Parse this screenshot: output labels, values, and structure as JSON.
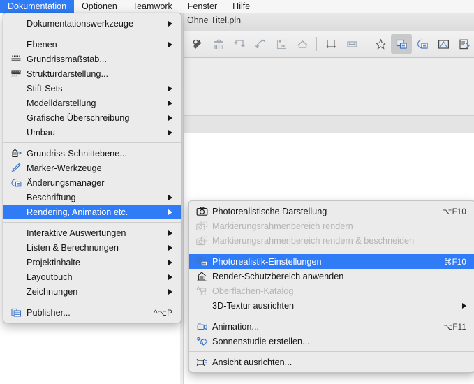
{
  "menubar": {
    "items": [
      {
        "label": "Dokumentation",
        "selected": true
      },
      {
        "label": "Optionen",
        "selected": false
      },
      {
        "label": "Teamwork",
        "selected": false
      },
      {
        "label": "Fenster",
        "selected": false
      },
      {
        "label": "Hilfe",
        "selected": false
      }
    ]
  },
  "window": {
    "title": "Ohne Titel.pln",
    "toolbar_icons": [
      "magic-wand-icon",
      "elevate-to-story-icon",
      "corner-snap-icon",
      "arc-tangent-icon",
      "move-to-layer-icon",
      "home-story-icon",
      "dimension-vertical-icon",
      "dimension-horizontal-icon",
      "favorites-star-icon",
      "layers-panel-icon",
      "renovation-filter-icon",
      "graphic-override-icon",
      "model-view-icon"
    ],
    "active_toolbar_icon": "layers-panel-icon"
  },
  "menu_dokumentation": {
    "name": "Dokumentation",
    "groups": [
      {
        "items": [
          {
            "label": "Dokumentationswerkzeuge",
            "icon": null,
            "submenu": true,
            "shortcut": "",
            "disabled": false,
            "highlight": false
          }
        ]
      },
      {
        "items": [
          {
            "label": "Ebenen",
            "icon": null,
            "submenu": true,
            "shortcut": "",
            "disabled": false,
            "highlight": false
          },
          {
            "label": "Grundrissmaßstab...",
            "icon": "scale-icon",
            "submenu": false,
            "shortcut": "",
            "disabled": false,
            "highlight": false
          },
          {
            "label": "Strukturdarstellung...",
            "icon": "structure-display-icon",
            "submenu": false,
            "shortcut": "",
            "disabled": false,
            "highlight": false
          },
          {
            "label": "Stift-Sets",
            "icon": null,
            "submenu": true,
            "shortcut": "",
            "disabled": false,
            "highlight": false
          },
          {
            "label": "Modelldarstellung",
            "icon": null,
            "submenu": true,
            "shortcut": "",
            "disabled": false,
            "highlight": false
          },
          {
            "label": "Grafische Überschreibung",
            "icon": null,
            "submenu": true,
            "shortcut": "",
            "disabled": false,
            "highlight": false
          },
          {
            "label": "Umbau",
            "icon": null,
            "submenu": true,
            "shortcut": "",
            "disabled": false,
            "highlight": false
          }
        ]
      },
      {
        "items": [
          {
            "label": "Grundriss-Schnittebene...",
            "icon": "floorplan-cutplane-icon",
            "submenu": false,
            "shortcut": "",
            "disabled": false,
            "highlight": false
          },
          {
            "label": "Marker-Werkzeuge",
            "icon": "marker-pen-icon",
            "submenu": false,
            "shortcut": "",
            "disabled": false,
            "highlight": false
          },
          {
            "label": "Änderungsmanager",
            "icon": "change-manager-icon",
            "submenu": false,
            "shortcut": "",
            "disabled": false,
            "highlight": false
          },
          {
            "label": "Beschriftung",
            "icon": null,
            "submenu": true,
            "shortcut": "",
            "disabled": false,
            "highlight": false
          },
          {
            "label": "Rendering, Animation etc.",
            "icon": null,
            "submenu": true,
            "shortcut": "",
            "disabled": false,
            "highlight": true
          }
        ]
      },
      {
        "items": [
          {
            "label": "Interaktive Auswertungen",
            "icon": null,
            "submenu": true,
            "shortcut": "",
            "disabled": false,
            "highlight": false
          },
          {
            "label": "Listen & Berechnungen",
            "icon": null,
            "submenu": true,
            "shortcut": "",
            "disabled": false,
            "highlight": false
          },
          {
            "label": "Projektinhalte",
            "icon": null,
            "submenu": true,
            "shortcut": "",
            "disabled": false,
            "highlight": false
          },
          {
            "label": "Layoutbuch",
            "icon": null,
            "submenu": true,
            "shortcut": "",
            "disabled": false,
            "highlight": false
          },
          {
            "label": "Zeichnungen",
            "icon": null,
            "submenu": true,
            "shortcut": "",
            "disabled": false,
            "highlight": false
          }
        ]
      },
      {
        "items": [
          {
            "label": "Publisher...",
            "icon": "publisher-icon",
            "submenu": false,
            "shortcut": "^⌥P",
            "disabled": false,
            "highlight": false
          }
        ]
      }
    ]
  },
  "menu_rendering": {
    "name": "Rendering, Animation etc.",
    "groups": [
      {
        "items": [
          {
            "label": "Photorealistische Darstellung",
            "icon": "camera-icon",
            "submenu": false,
            "shortcut": "⌥F10",
            "disabled": false,
            "highlight": false
          },
          {
            "label": "Markierungsrahmenbereich rendern",
            "icon": "camera-marquee-icon",
            "submenu": false,
            "shortcut": "",
            "disabled": true,
            "highlight": false
          },
          {
            "label": "Markierungsrahmenbereich rendern & beschneiden",
            "icon": "camera-marquee-crop-icon",
            "submenu": false,
            "shortcut": "",
            "disabled": true,
            "highlight": false
          }
        ]
      },
      {
        "items": [
          {
            "label": "Photorealistik-Einstellungen",
            "icon": "camera-settings-icon",
            "submenu": false,
            "shortcut": "⌘F10",
            "disabled": false,
            "highlight": true
          },
          {
            "label": "Render-Schutzbereich anwenden",
            "icon": "render-protect-icon",
            "submenu": false,
            "shortcut": "",
            "disabled": false,
            "highlight": false
          },
          {
            "label": "Oberflächen-Katalog",
            "icon": "surface-catalog-icon",
            "submenu": false,
            "shortcut": "",
            "disabled": true,
            "highlight": false
          },
          {
            "label": "3D-Textur ausrichten",
            "icon": null,
            "submenu": true,
            "shortcut": "",
            "disabled": false,
            "highlight": false
          }
        ]
      },
      {
        "items": [
          {
            "label": "Animation...",
            "icon": "video-camera-icon",
            "submenu": false,
            "shortcut": "⌥F11",
            "disabled": false,
            "highlight": false
          },
          {
            "label": "Sonnenstudie erstellen...",
            "icon": "sun-study-icon",
            "submenu": false,
            "shortcut": "",
            "disabled": false,
            "highlight": false
          }
        ]
      },
      {
        "items": [
          {
            "label": "Ansicht ausrichten...",
            "icon": "align-view-icon",
            "submenu": false,
            "shortcut": "",
            "disabled": false,
            "highlight": false
          }
        ]
      }
    ]
  },
  "colors": {
    "accent": "#2f7cf6",
    "menu_bg": "#ebebeb",
    "text": "#141414",
    "disabled_text": "#b4b4b4",
    "icon_blue": "#3d73c4"
  }
}
